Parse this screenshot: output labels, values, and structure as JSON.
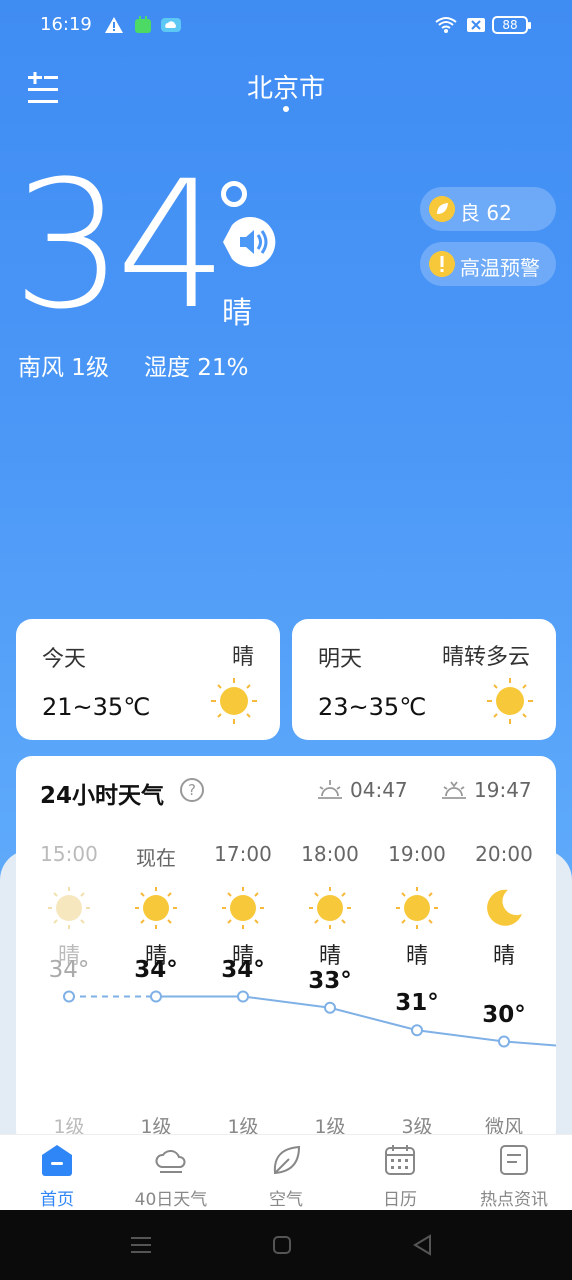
{
  "status_bar": {
    "time": "16:19",
    "battery": "88"
  },
  "header": {
    "city": "北京市"
  },
  "current": {
    "temperature": "34",
    "condition": "晴",
    "wind": "南风 1级",
    "humidity": "湿度 21%",
    "aqi_label": "良 62",
    "alert_label": "高温预警"
  },
  "days": [
    {
      "name": "今天",
      "condition": "晴",
      "range": "21~35℃",
      "icon": "sun-icon"
    },
    {
      "name": "明天",
      "condition": "晴转多云",
      "range": "23~35℃",
      "icon": "sun-icon"
    }
  ],
  "hourly": {
    "title": "24小时天气",
    "help": "?",
    "sunrise": "04:47",
    "sunset": "19:47",
    "items": [
      {
        "time": "15:00",
        "condition": "晴",
        "temp": "34°",
        "wind": "1级",
        "icon": "sun-icon",
        "past": true
      },
      {
        "time": "现在",
        "condition": "晴",
        "temp": "34°",
        "wind": "1级",
        "icon": "sun-icon",
        "past": false
      },
      {
        "time": "17:00",
        "condition": "晴",
        "temp": "34°",
        "wind": "1级",
        "icon": "sun-icon",
        "past": false
      },
      {
        "time": "18:00",
        "condition": "晴",
        "temp": "33°",
        "wind": "1级",
        "icon": "sun-icon",
        "past": false
      },
      {
        "time": "19:00",
        "condition": "晴",
        "temp": "31°",
        "wind": "3级",
        "icon": "sun-icon",
        "past": false
      },
      {
        "time": "20:00",
        "condition": "晴",
        "temp": "30°",
        "wind": "微风",
        "icon": "moon-icon",
        "past": false
      }
    ]
  },
  "nav": [
    {
      "label": "首页",
      "icon": "home-icon",
      "active": true
    },
    {
      "label": "40日天气",
      "icon": "cloud-icon",
      "active": false
    },
    {
      "label": "空气",
      "icon": "leaf-icon",
      "active": false
    },
    {
      "label": "日历",
      "icon": "calendar-icon",
      "active": false
    },
    {
      "label": "热点资讯",
      "icon": "news-icon",
      "active": false
    }
  ],
  "colors": {
    "accent": "#2f86f6",
    "sun": "#f8c83b",
    "line": "#7fb0e6"
  }
}
